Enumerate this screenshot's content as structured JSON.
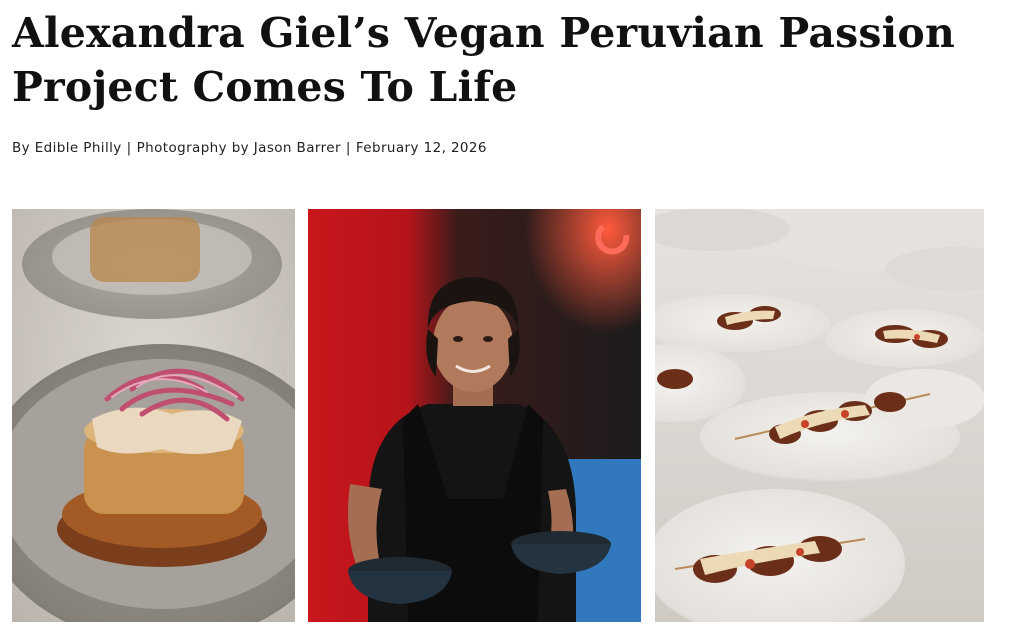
{
  "article": {
    "title": "Alexandra Giel’s Vegan Peruvian Passion Project Comes To Life",
    "byline": {
      "author": "By Edible Philly",
      "photographer": "Photography by Jason Barrer",
      "date": "February 12, 2026",
      "separator": "|"
    }
  },
  "gallery": {
    "photos": [
      {
        "subject": "plated-dish-closeup"
      },
      {
        "subject": "chef-portrait-with-bowls"
      },
      {
        "subject": "plates-with-skewers"
      }
    ]
  }
}
